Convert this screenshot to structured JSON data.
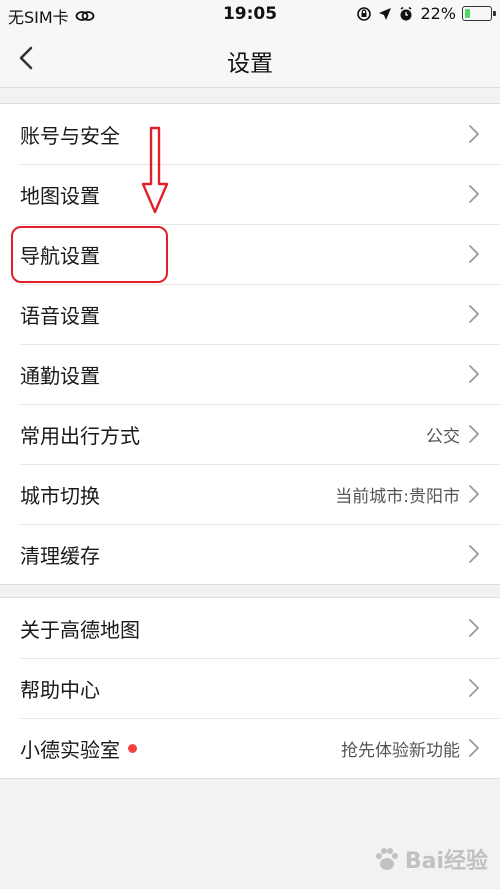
{
  "status_bar": {
    "carrier": "无SIM卡",
    "time": "19:05",
    "battery_percent": "22%",
    "battery_level": 0.22,
    "icons": [
      "link-icon",
      "rotation-lock-icon",
      "location-icon",
      "alarm-icon",
      "battery-icon"
    ]
  },
  "nav": {
    "title": "设置",
    "back_icon": "chevron-left-icon"
  },
  "group1": [
    {
      "label": "账号与安全",
      "value": ""
    },
    {
      "label": "地图设置",
      "value": ""
    },
    {
      "label": "导航设置",
      "value": ""
    },
    {
      "label": "语音设置",
      "value": ""
    },
    {
      "label": "通勤设置",
      "value": ""
    },
    {
      "label": "常用出行方式",
      "value": "公交"
    },
    {
      "label": "城市切换",
      "value": "当前城市:贵阳市"
    },
    {
      "label": "清理缓存",
      "value": ""
    }
  ],
  "group2": [
    {
      "label": "关于高德地图",
      "value": ""
    },
    {
      "label": "帮助中心",
      "value": ""
    },
    {
      "label": "小德实验室",
      "value": "抢先体验新功能",
      "badge": "red-dot"
    }
  ],
  "annotation": {
    "highlight_color": "#e0202b"
  },
  "watermark": {
    "text": "Bai经验"
  }
}
